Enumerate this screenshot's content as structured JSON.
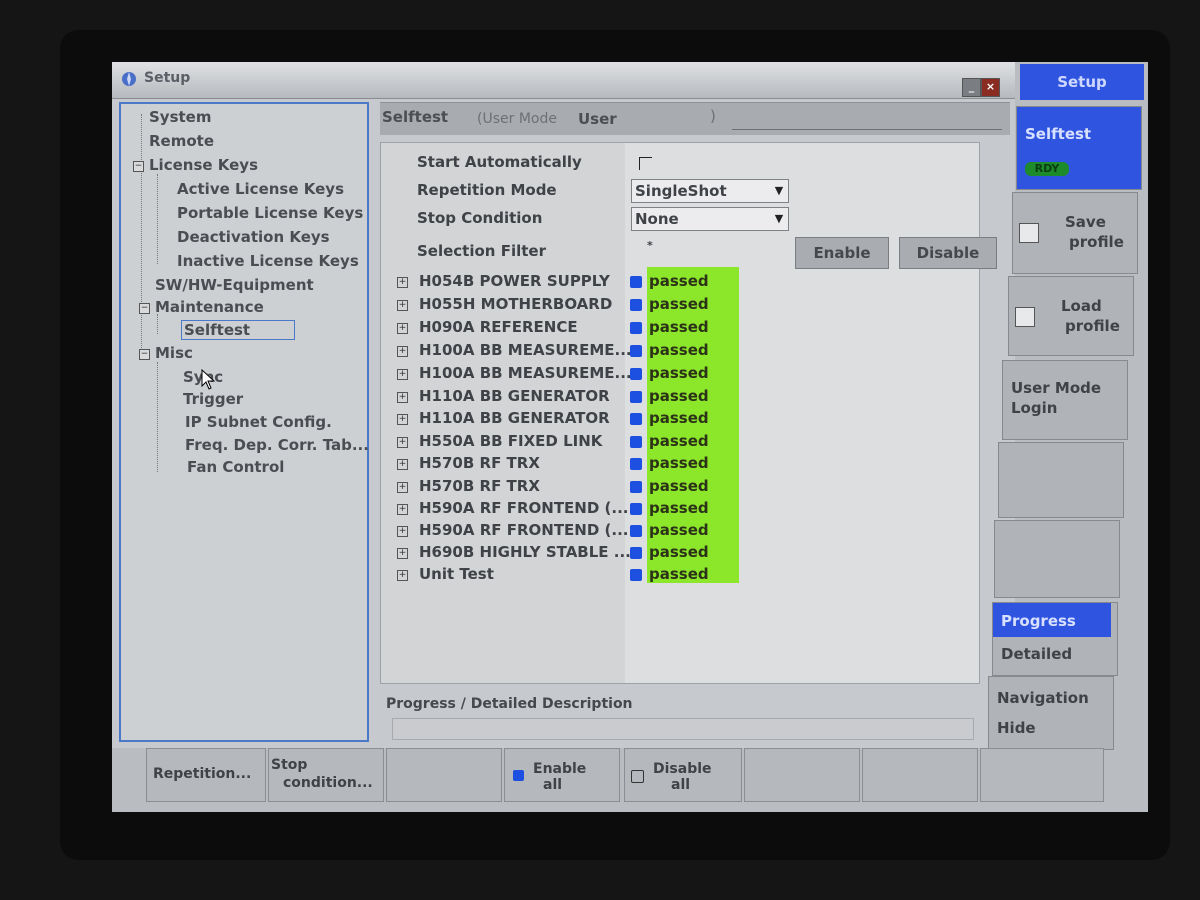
{
  "window": {
    "title": "Setup"
  },
  "tree": {
    "items": [
      {
        "label": "System"
      },
      {
        "label": "Remote"
      },
      {
        "label": "License Keys"
      },
      {
        "label": "Active License Keys"
      },
      {
        "label": "Portable License Keys"
      },
      {
        "label": "Deactivation Keys"
      },
      {
        "label": "Inactive License Keys"
      },
      {
        "label": "SW/HW-Equipment"
      },
      {
        "label": "Maintenance"
      },
      {
        "label": "Selftest"
      },
      {
        "label": "Misc"
      },
      {
        "label": "Sync"
      },
      {
        "label": "Trigger"
      },
      {
        "label": "IP Subnet Config."
      },
      {
        "label": "Freq. Dep. Corr. Tab..."
      },
      {
        "label": "Fan Control"
      }
    ],
    "selected": "Selftest"
  },
  "header": {
    "title": "Selftest",
    "user_mode_label": "(User Mode",
    "user_mode_value": "User",
    "close_paren": ")"
  },
  "settings": {
    "start_auto_label": "Start Automatically",
    "start_auto_checked": false,
    "repetition_label": "Repetition Mode",
    "repetition_value": "SingleShot",
    "stop_label": "Stop Condition",
    "stop_value": "None",
    "filter_label": "Selection Filter",
    "filter_value": "*",
    "enable_label": "Enable",
    "disable_label": "Disable"
  },
  "tests": [
    {
      "name": "H054B POWER SUPPLY",
      "status": "passed"
    },
    {
      "name": "H055H MOTHERBOARD",
      "status": "passed"
    },
    {
      "name": "H090A REFERENCE",
      "status": "passed"
    },
    {
      "name": "H100A BB MEASUREME...",
      "status": "passed"
    },
    {
      "name": "H100A BB MEASUREME...",
      "status": "passed"
    },
    {
      "name": "H110A BB GENERATOR",
      "status": "passed"
    },
    {
      "name": "H110A BB GENERATOR",
      "status": "passed"
    },
    {
      "name": "H550A BB FIXED LINK",
      "status": "passed"
    },
    {
      "name": "H570B RF TRX",
      "status": "passed"
    },
    {
      "name": "H570B RF TRX",
      "status": "passed"
    },
    {
      "name": "H590A RF FRONTEND (...",
      "status": "passed"
    },
    {
      "name": "H590A RF FRONTEND (...",
      "status": "passed"
    },
    {
      "name": "H690B HIGHLY STABLE ...",
      "status": "passed"
    },
    {
      "name": "Unit Test",
      "status": "passed"
    }
  ],
  "progress": {
    "label": "Progress / Detailed Description"
  },
  "softkeys_right": {
    "header": "Setup",
    "selftest": "Selftest",
    "rdy": "RDY",
    "save_line1": "Save",
    "save_line2": "profile",
    "load_line1": "Load",
    "load_line2": "profile",
    "usermode_line1": "User Mode",
    "usermode_line2": "Login",
    "progress": "Progress",
    "detailed": "Detailed",
    "navigation": "Navigation",
    "hide": "Hide"
  },
  "softkeys_bottom": {
    "repetition": "Repetition...",
    "stop_line1": "Stop",
    "stop_line2": "condition...",
    "enable_line1": "Enable",
    "enable_line2": "all",
    "disable_line1": "Disable",
    "disable_line2": "all"
  },
  "colors": {
    "accent": "#2f55e0",
    "passed_bg": "#8ce62a",
    "status_dot": "#1d4fe0"
  }
}
